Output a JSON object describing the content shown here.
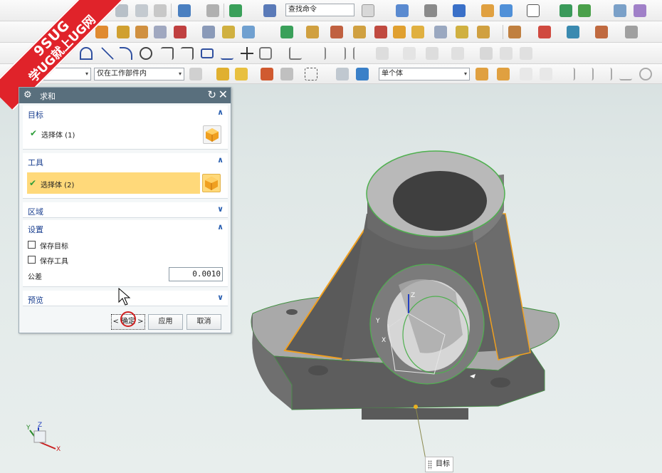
{
  "watermark": {
    "line1": "9SUG",
    "line2": "学UG就上UG网"
  },
  "toolbar": {
    "command_search": "查找命令",
    "filter_scope": "仅在工作部件内",
    "body_filter": "单个体"
  },
  "dialog": {
    "title": "求和",
    "target": {
      "header": "目标",
      "select_label": "选择体 (1)"
    },
    "tool": {
      "header": "工具",
      "select_label": "选择体 (2)"
    },
    "region": {
      "header": "区域"
    },
    "settings": {
      "header": "设置",
      "keep_target": "保存目标",
      "keep_tool": "保存工具",
      "tolerance_label": "公差",
      "tolerance_value": "0.0010"
    },
    "preview": {
      "header": "预览"
    },
    "buttons": {
      "ok": "< 确定 >",
      "apply": "应用",
      "cancel": "取消"
    }
  },
  "viewport": {
    "target_tag": "目标",
    "triad": {
      "x": "X",
      "y": "Y",
      "z": "Z"
    },
    "csys": {
      "x": "X",
      "y": "Y",
      "z": "Z"
    }
  },
  "colors": {
    "dialog_title_bg": "#596f7d",
    "section_header_text": "#1a3f8f",
    "highlight_row": "#ffd97a",
    "model_dark": "#5d5d5d",
    "model_light": "#8a8a8a",
    "edge_highlight": "#f0a020",
    "selection_edge": "#4fb04f"
  }
}
